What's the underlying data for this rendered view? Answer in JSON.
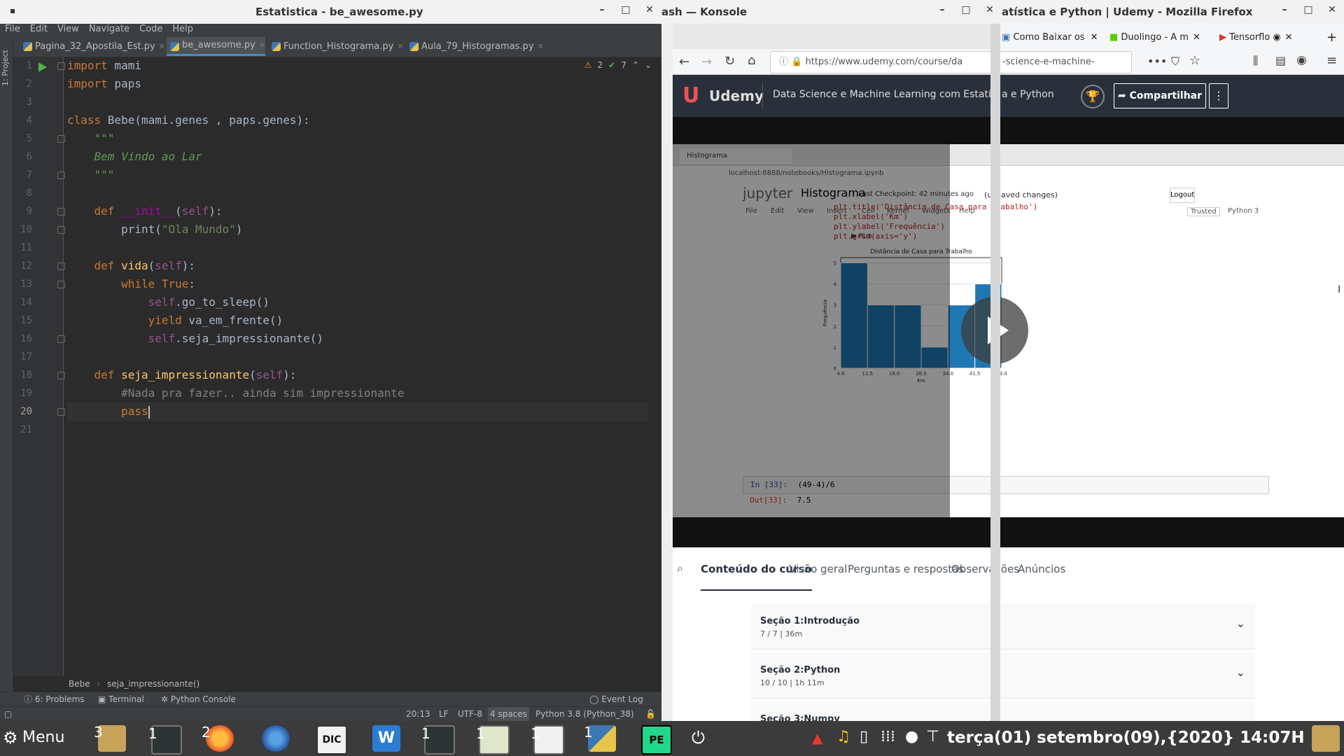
{
  "ide": {
    "window_title": "Estatistica - be_awesome.py",
    "menu": [
      "File",
      "Edit",
      "View",
      "Navigate",
      "Code",
      "Help"
    ],
    "tabs": [
      "Pagina_32_Apostila_Est.py",
      "be_awesome.py",
      "Function_Histograma.py",
      "Aula_79_Histogramas.py"
    ],
    "active_tab": "be_awesome.py",
    "project_label": "1: Project",
    "inspections": {
      "warnings": "2",
      "ok": "7"
    },
    "line_numbers": [
      "1",
      "2",
      "3",
      "4",
      "5",
      "6",
      "7",
      "8",
      "9",
      "10",
      "11",
      "12",
      "13",
      "14",
      "15",
      "16",
      "17",
      "18",
      "19",
      "20",
      "21"
    ],
    "code": {
      "l1_kw": "import",
      "l1_mod": " mami",
      "l2_kw": "import",
      "l2_mod": " paps",
      "l4_kw": "class",
      "l4_rest": " Bebe(mami.genes , paps.genes):",
      "l5": "\"\"\"",
      "l6": "Bem Vindo ao Lar",
      "l7": "\"\"\"",
      "l9_kw": "def ",
      "l9_fn": "__init__",
      "l9_a": "(",
      "l9_self": "self",
      "l9_b": "):",
      "l10_a": "print(",
      "l10_str": "\"Ola Mundo\"",
      "l10_b": ")",
      "l12_kw": "def ",
      "l12_fn": "vida",
      "l12_a": "(",
      "l12_self": "self",
      "l12_b": "):",
      "l13_kw": "while ",
      "l13_true": "True",
      "l13_b": ":",
      "l14_self": "self",
      "l14_rest": ".go_to_sleep()",
      "l15_kw": "yield",
      "l15_rest": " va_em_frente()",
      "l16_self": "self",
      "l16_rest": ".seja_impressionante()",
      "l18_kw": "def ",
      "l18_fn": "seja_impressionante",
      "l18_a": "(",
      "l18_self": "self",
      "l18_b": "):",
      "l19": "#Nada pra fazer.. ainda sim impressionante",
      "l20_kw": "pass"
    },
    "breadcrumb": [
      "Bebe",
      "seja_impressionante()"
    ],
    "tool_windows": [
      "6: Problems",
      "Terminal",
      "Python Console"
    ],
    "event_log": "Event Log",
    "status": {
      "position": "20:13",
      "line_sep": "LF",
      "encoding": "UTF-8",
      "indent": "4 spaces",
      "interpreter": "Python 3.8 (Python_38)"
    }
  },
  "konsole": {
    "window_title": "ash — Konsole"
  },
  "firefox": {
    "window_title": "atística e Python | Udemy - Mozilla Firefox",
    "tabs": [
      "Como Baixar os",
      "Duolingo - A m",
      "Tensorflo"
    ],
    "url": "https://www.udemy.com/course/da",
    "url_right": "-science-e-machine-learning"
  },
  "udemy": {
    "logo": "Udemy",
    "course_title": "Data Science e Machine Learning com Estatís",
    "course_title_right": "a e Python",
    "share_button": "Compartilhar",
    "nav": [
      "Conteúdo do curso",
      "Visão geral",
      "Perguntas e respostas",
      "Observações",
      "Anúncios"
    ],
    "sections": [
      {
        "title": "Seção 1:Introdução",
        "meta": "7 / 7 | 36m"
      },
      {
        "title": "Seção 2:Python",
        "meta": "10 / 10 | 1h 11m"
      },
      {
        "title": "Seção 3:Numpy",
        "meta": ""
      }
    ]
  },
  "jupyter": {
    "tab_title": "Histograma",
    "url": "localhost:8888/notebooks/Histograma.ipynb",
    "brand": "jupyter",
    "notebook": "Histograma",
    "checkpoint": "Last Checkpoint: 42 minutes ago",
    "unsaved": "(unsaved changes)",
    "logout": "Logout",
    "menu": [
      "File",
      "Edit",
      "View",
      "Insert",
      "Cell",
      "Kernel",
      "Widgets",
      "Help"
    ],
    "trusted": "Trusted",
    "kernel": "Python 3",
    "run": "Run",
    "code_lines": [
      "plt.title('Distância de Casa para Trabalho')",
      "plt.xlabel('Km')",
      "plt.ylabel('Frequência')",
      "plt.grid(axis='y')"
    ],
    "in_prompt": "In [33]:",
    "in_code": "(49-4)/6",
    "out_prompt": "Out[33]:",
    "out_value": "7.5"
  },
  "chart_data": {
    "type": "bar",
    "title": "Distância de Casa para Trabalho",
    "xlabel": "Km",
    "ylabel": "Frequência",
    "x_ticks": [
      "4.0",
      "11.5",
      "19.0",
      "26.5",
      "34.0",
      "41.5",
      "49.0"
    ],
    "y_ticks": [
      "0",
      "1",
      "2",
      "3",
      "4",
      "5"
    ],
    "bin_edges": [
      4.0,
      11.5,
      19.0,
      26.5,
      34.0,
      41.5,
      49.0
    ],
    "values": [
      5,
      3,
      3,
      1,
      3,
      4
    ],
    "ylim": [
      0,
      5.25
    ],
    "grid": "y",
    "color": "#1f77b4"
  },
  "taskbar": {
    "menu_label": "Menu",
    "clock": "terça(01) setembro(09),{2020} 14:07H",
    "counts": [
      "3",
      "1",
      "2",
      "1",
      "1",
      "1",
      "1"
    ]
  }
}
